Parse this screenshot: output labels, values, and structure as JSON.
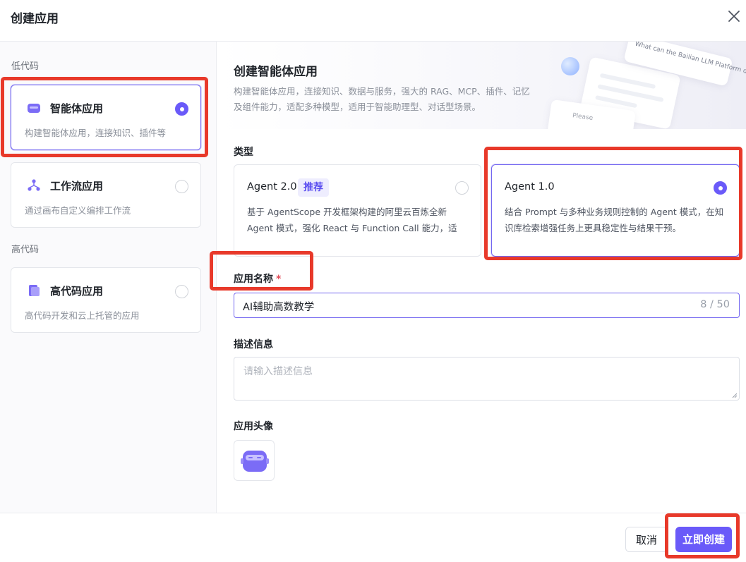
{
  "dialog": {
    "title": "创建应用",
    "close_icon": "close-icon"
  },
  "sidebar": {
    "groups": [
      {
        "label": "低代码",
        "items": [
          {
            "name": "智能体应用",
            "desc": "构建智能体应用，连接知识、插件等",
            "icon": "agent-app-icon",
            "selected": true
          },
          {
            "name": "工作流应用",
            "desc": "通过画布自定义编排工作流",
            "icon": "workflow-icon",
            "selected": false
          }
        ]
      },
      {
        "label": "高代码",
        "items": [
          {
            "name": "高代码应用",
            "desc": "高代码开发和云上托管的应用",
            "icon": "high-code-app-icon",
            "selected": false
          }
        ]
      }
    ]
  },
  "banner": {
    "title": "创建智能体应用",
    "desc": "构建智能体应用，连接知识、数据与服务，强大的 RAG、MCP、插件、记忆及组件能力，适配多种模型，适用于智能助理型、对话型场景。",
    "deco_text": "What can the Bailian LLM Platform do?",
    "deco_placeholder": "Please"
  },
  "form": {
    "type_label": "类型",
    "types": [
      {
        "name": "Agent 2.0",
        "tag": "推荐",
        "desc": "基于 AgentScope 开发框架构建的阿里云百炼全新 Agent 模式，强化 React 与 Function Call 能力，适用…",
        "selected": false
      },
      {
        "name": "Agent 1.0",
        "tag": "",
        "desc": "结合 Prompt 与多种业务规则控制的 Agent 模式，在知识库检索增强任务上更具稳定性与结果干预。",
        "selected": true
      }
    ],
    "name_label": "应用名称",
    "required_mark": "*",
    "name_value": "AI辅助高数教学",
    "name_count": "8 / 50",
    "desc_label": "描述信息",
    "desc_placeholder": "请输入描述信息",
    "avatar_label": "应用头像",
    "avatar_icon": "robot-avatar-icon"
  },
  "footer": {
    "cancel_label": "取消",
    "create_label": "立即创建"
  },
  "colors": {
    "accent": "#6a5af9",
    "highlight": "#e8392a",
    "tag_bg": "#eeedfe"
  }
}
